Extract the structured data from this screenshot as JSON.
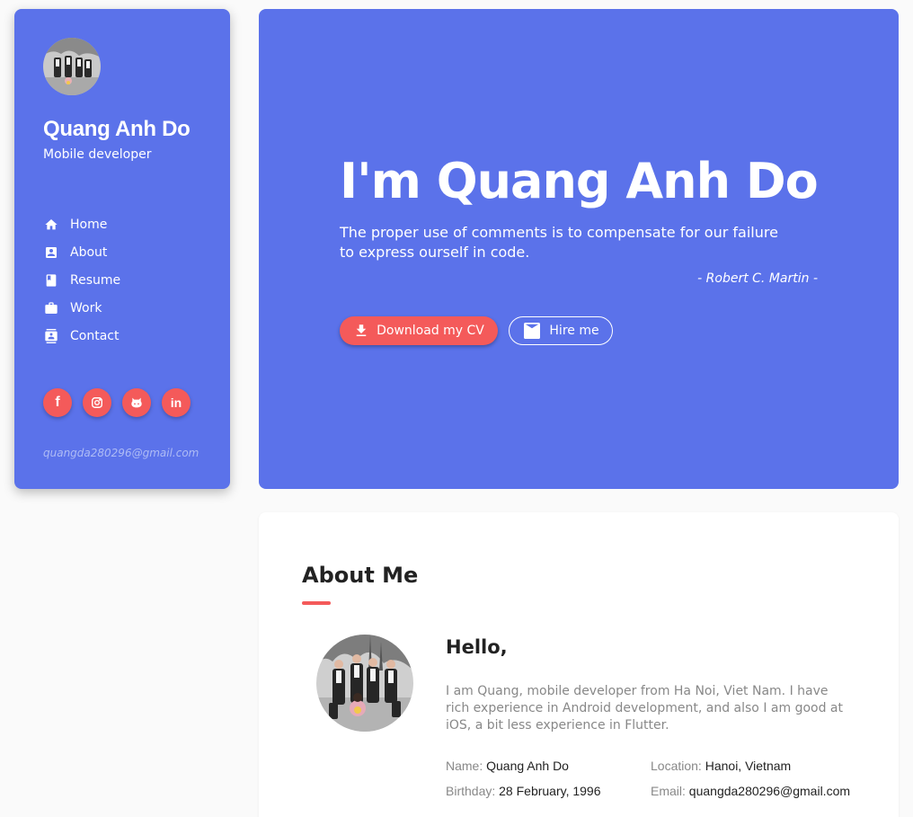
{
  "sidebar": {
    "name": "Quang Anh Do",
    "role": "Mobile developer",
    "nav": [
      {
        "label": "Home",
        "icon": "home-icon"
      },
      {
        "label": "About",
        "icon": "account-box-icon"
      },
      {
        "label": "Resume",
        "icon": "book-icon"
      },
      {
        "label": "Work",
        "icon": "briefcase-icon"
      },
      {
        "label": "Contact",
        "icon": "contacts-icon"
      }
    ],
    "socials": [
      {
        "icon": "facebook-icon",
        "glyph": "f"
      },
      {
        "icon": "instagram-icon"
      },
      {
        "icon": "github-icon"
      },
      {
        "icon": "linkedin-icon",
        "glyph": "in"
      }
    ],
    "email": "quangda280296@gmail.com"
  },
  "hero": {
    "title": "I'm Quang Anh Do",
    "quote": "The proper use of comments is to compensate for our failure to express ourself in code.",
    "author": "- Robert C. Martin -",
    "download_label": "Download my CV",
    "hire_label": "Hire me"
  },
  "about": {
    "heading": "About Me",
    "hello": "Hello,",
    "bio": "I am Quang, mobile developer from Ha Noi, Viet Nam. I have rich experience in Android development, and also I am good at iOS, a bit less experience in Flutter.",
    "info": [
      {
        "label": "Name:",
        "value": "Quang Anh Do"
      },
      {
        "label": "Location:",
        "value": "Hanoi, Vietnam"
      },
      {
        "label": "Birthday:",
        "value": "28 February, 1996"
      },
      {
        "label": "Email:",
        "value": "quangda280296@gmail.com"
      }
    ]
  },
  "colors": {
    "primary": "#5b72ea",
    "accent": "#f45a5a",
    "background": "#fafafa"
  }
}
